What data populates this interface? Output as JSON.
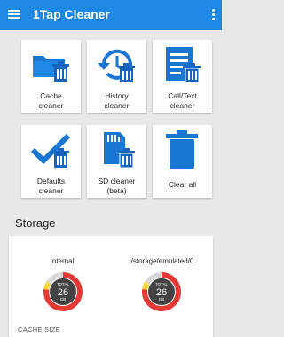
{
  "toolbar": {
    "title": "1Tap Cleaner",
    "menu_icon": "hamburger-menu-icon",
    "overflow_icon": "more-vert-icon",
    "color": "#1e88e5"
  },
  "tiles": [
    {
      "label": "Cache\ncleaner",
      "icon": "folder-trash-icon"
    },
    {
      "label": "History\ncleaner",
      "icon": "history-trash-icon"
    },
    {
      "label": "Call/Text\ncleaner",
      "icon": "document-trash-icon"
    },
    {
      "label": "Defaults\ncleaner",
      "icon": "check-trash-icon"
    },
    {
      "label": "SD cleaner\n(beta)",
      "icon": "sdcard-trash-icon"
    },
    {
      "label": "Clear all",
      "icon": "trash-icon"
    }
  ],
  "storage": {
    "title": "Storage",
    "volumes": [
      {
        "name": "Internal",
        "total_label": "TOTAL",
        "total_value": "26",
        "unit": "GB"
      },
      {
        "name": "/storage/emulated/0",
        "total_label": "TOTAL",
        "total_value": "26",
        "unit": "GB"
      }
    ],
    "cache_size_label": "CACHE SIZE"
  },
  "colors": {
    "icon_blue": "#1976d2",
    "ring_red": "#e53935",
    "ring_yellow": "#fdd835",
    "ring_gray": "#d7d7d7",
    "donut_center": "#424242"
  }
}
